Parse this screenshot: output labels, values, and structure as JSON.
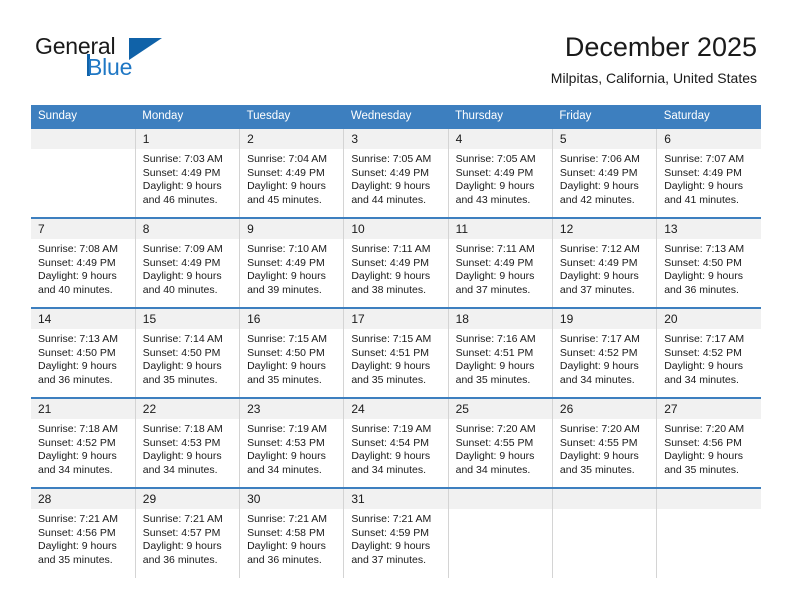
{
  "brand": {
    "name_part1": "General",
    "name_part2": "Blue",
    "accent_color": "#1062a8",
    "blue_text_color": "#1f77c4"
  },
  "header": {
    "title": "December 2025",
    "subtitle": "Milpitas, California, United States"
  },
  "theme": {
    "header_row_bg": "#3d7fbf",
    "daynum_bg": "#f1f1f1",
    "grid_line": "#d4d4d4"
  },
  "weekdays": [
    "Sunday",
    "Monday",
    "Tuesday",
    "Wednesday",
    "Thursday",
    "Friday",
    "Saturday"
  ],
  "labels": {
    "sunrise_prefix": "Sunrise:",
    "sunset_prefix": "Sunset:",
    "daylight_prefix": "Daylight:"
  },
  "weeks": [
    [
      {
        "day": "",
        "empty": true,
        "l1": "",
        "l2": "",
        "l3": "",
        "l4": ""
      },
      {
        "day": "1",
        "l1": "Sunrise: 7:03 AM",
        "l2": "Sunset: 4:49 PM",
        "l3": "Daylight: 9 hours",
        "l4": "and 46 minutes."
      },
      {
        "day": "2",
        "l1": "Sunrise: 7:04 AM",
        "l2": "Sunset: 4:49 PM",
        "l3": "Daylight: 9 hours",
        "l4": "and 45 minutes."
      },
      {
        "day": "3",
        "l1": "Sunrise: 7:05 AM",
        "l2": "Sunset: 4:49 PM",
        "l3": "Daylight: 9 hours",
        "l4": "and 44 minutes."
      },
      {
        "day": "4",
        "l1": "Sunrise: 7:05 AM",
        "l2": "Sunset: 4:49 PM",
        "l3": "Daylight: 9 hours",
        "l4": "and 43 minutes."
      },
      {
        "day": "5",
        "l1": "Sunrise: 7:06 AM",
        "l2": "Sunset: 4:49 PM",
        "l3": "Daylight: 9 hours",
        "l4": "and 42 minutes."
      },
      {
        "day": "6",
        "l1": "Sunrise: 7:07 AM",
        "l2": "Sunset: 4:49 PM",
        "l3": "Daylight: 9 hours",
        "l4": "and 41 minutes."
      }
    ],
    [
      {
        "day": "7",
        "l1": "Sunrise: 7:08 AM",
        "l2": "Sunset: 4:49 PM",
        "l3": "Daylight: 9 hours",
        "l4": "and 40 minutes."
      },
      {
        "day": "8",
        "l1": "Sunrise: 7:09 AM",
        "l2": "Sunset: 4:49 PM",
        "l3": "Daylight: 9 hours",
        "l4": "and 40 minutes."
      },
      {
        "day": "9",
        "l1": "Sunrise: 7:10 AM",
        "l2": "Sunset: 4:49 PM",
        "l3": "Daylight: 9 hours",
        "l4": "and 39 minutes."
      },
      {
        "day": "10",
        "l1": "Sunrise: 7:11 AM",
        "l2": "Sunset: 4:49 PM",
        "l3": "Daylight: 9 hours",
        "l4": "and 38 minutes."
      },
      {
        "day": "11",
        "l1": "Sunrise: 7:11 AM",
        "l2": "Sunset: 4:49 PM",
        "l3": "Daylight: 9 hours",
        "l4": "and 37 minutes."
      },
      {
        "day": "12",
        "l1": "Sunrise: 7:12 AM",
        "l2": "Sunset: 4:49 PM",
        "l3": "Daylight: 9 hours",
        "l4": "and 37 minutes."
      },
      {
        "day": "13",
        "l1": "Sunrise: 7:13 AM",
        "l2": "Sunset: 4:50 PM",
        "l3": "Daylight: 9 hours",
        "l4": "and 36 minutes."
      }
    ],
    [
      {
        "day": "14",
        "l1": "Sunrise: 7:13 AM",
        "l2": "Sunset: 4:50 PM",
        "l3": "Daylight: 9 hours",
        "l4": "and 36 minutes."
      },
      {
        "day": "15",
        "l1": "Sunrise: 7:14 AM",
        "l2": "Sunset: 4:50 PM",
        "l3": "Daylight: 9 hours",
        "l4": "and 35 minutes."
      },
      {
        "day": "16",
        "l1": "Sunrise: 7:15 AM",
        "l2": "Sunset: 4:50 PM",
        "l3": "Daylight: 9 hours",
        "l4": "and 35 minutes."
      },
      {
        "day": "17",
        "l1": "Sunrise: 7:15 AM",
        "l2": "Sunset: 4:51 PM",
        "l3": "Daylight: 9 hours",
        "l4": "and 35 minutes."
      },
      {
        "day": "18",
        "l1": "Sunrise: 7:16 AM",
        "l2": "Sunset: 4:51 PM",
        "l3": "Daylight: 9 hours",
        "l4": "and 35 minutes."
      },
      {
        "day": "19",
        "l1": "Sunrise: 7:17 AM",
        "l2": "Sunset: 4:52 PM",
        "l3": "Daylight: 9 hours",
        "l4": "and 34 minutes."
      },
      {
        "day": "20",
        "l1": "Sunrise: 7:17 AM",
        "l2": "Sunset: 4:52 PM",
        "l3": "Daylight: 9 hours",
        "l4": "and 34 minutes."
      }
    ],
    [
      {
        "day": "21",
        "l1": "Sunrise: 7:18 AM",
        "l2": "Sunset: 4:52 PM",
        "l3": "Daylight: 9 hours",
        "l4": "and 34 minutes."
      },
      {
        "day": "22",
        "l1": "Sunrise: 7:18 AM",
        "l2": "Sunset: 4:53 PM",
        "l3": "Daylight: 9 hours",
        "l4": "and 34 minutes."
      },
      {
        "day": "23",
        "l1": "Sunrise: 7:19 AM",
        "l2": "Sunset: 4:53 PM",
        "l3": "Daylight: 9 hours",
        "l4": "and 34 minutes."
      },
      {
        "day": "24",
        "l1": "Sunrise: 7:19 AM",
        "l2": "Sunset: 4:54 PM",
        "l3": "Daylight: 9 hours",
        "l4": "and 34 minutes."
      },
      {
        "day": "25",
        "l1": "Sunrise: 7:20 AM",
        "l2": "Sunset: 4:55 PM",
        "l3": "Daylight: 9 hours",
        "l4": "and 34 minutes."
      },
      {
        "day": "26",
        "l1": "Sunrise: 7:20 AM",
        "l2": "Sunset: 4:55 PM",
        "l3": "Daylight: 9 hours",
        "l4": "and 35 minutes."
      },
      {
        "day": "27",
        "l1": "Sunrise: 7:20 AM",
        "l2": "Sunset: 4:56 PM",
        "l3": "Daylight: 9 hours",
        "l4": "and 35 minutes."
      }
    ],
    [
      {
        "day": "28",
        "l1": "Sunrise: 7:21 AM",
        "l2": "Sunset: 4:56 PM",
        "l3": "Daylight: 9 hours",
        "l4": "and 35 minutes."
      },
      {
        "day": "29",
        "l1": "Sunrise: 7:21 AM",
        "l2": "Sunset: 4:57 PM",
        "l3": "Daylight: 9 hours",
        "l4": "and 36 minutes."
      },
      {
        "day": "30",
        "l1": "Sunrise: 7:21 AM",
        "l2": "Sunset: 4:58 PM",
        "l3": "Daylight: 9 hours",
        "l4": "and 36 minutes."
      },
      {
        "day": "31",
        "l1": "Sunrise: 7:21 AM",
        "l2": "Sunset: 4:59 PM",
        "l3": "Daylight: 9 hours",
        "l4": "and 37 minutes."
      },
      {
        "day": "",
        "empty": true,
        "l1": "",
        "l2": "",
        "l3": "",
        "l4": ""
      },
      {
        "day": "",
        "empty": true,
        "l1": "",
        "l2": "",
        "l3": "",
        "l4": ""
      },
      {
        "day": "",
        "empty": true,
        "l1": "",
        "l2": "",
        "l3": "",
        "l4": ""
      }
    ]
  ]
}
